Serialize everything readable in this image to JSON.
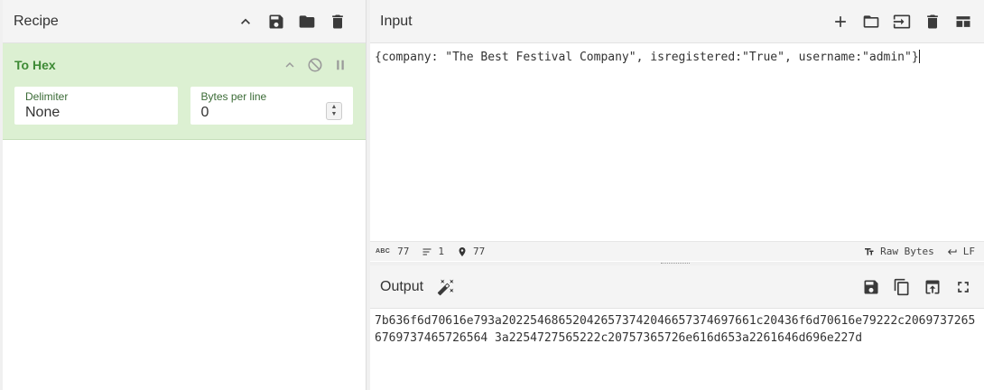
{
  "recipe": {
    "title": "Recipe",
    "header_icons": [
      "chevron-up-icon",
      "save-icon",
      "folder-icon",
      "trash-icon"
    ],
    "operation": {
      "name": "To Hex",
      "controls": [
        "chevron-up-icon",
        "disable-icon",
        "pause-icon"
      ],
      "args": [
        {
          "label": "Delimiter",
          "value": "None"
        },
        {
          "label": "Bytes per line",
          "value": "0"
        }
      ],
      "accent_color": "#3d8a35",
      "background_color": "#dcf0d2"
    }
  },
  "input": {
    "title": "Input",
    "header_icons": [
      "plus-icon",
      "folder-icon",
      "import-icon",
      "trash-icon",
      "layout-icon"
    ],
    "text": "{company: \"The Best Festival Company\", isregistered:\"True\", username:\"admin\"}",
    "status": {
      "length": "77",
      "lines": "1",
      "position": "77",
      "encoding": "Raw Bytes",
      "eol": "LF"
    }
  },
  "output": {
    "title": "Output",
    "header_icons": [
      "magic-wand-icon",
      "save-icon",
      "copy-icon",
      "replace-input-icon",
      "fullscreen-icon"
    ],
    "text": "7b636f6d70616e793a202254686520426573742046657374697661c20436f6d70616e79222c20697372656769737465726564 3a2254727565222c20757365726e616d653a2261646d696e227d"
  }
}
